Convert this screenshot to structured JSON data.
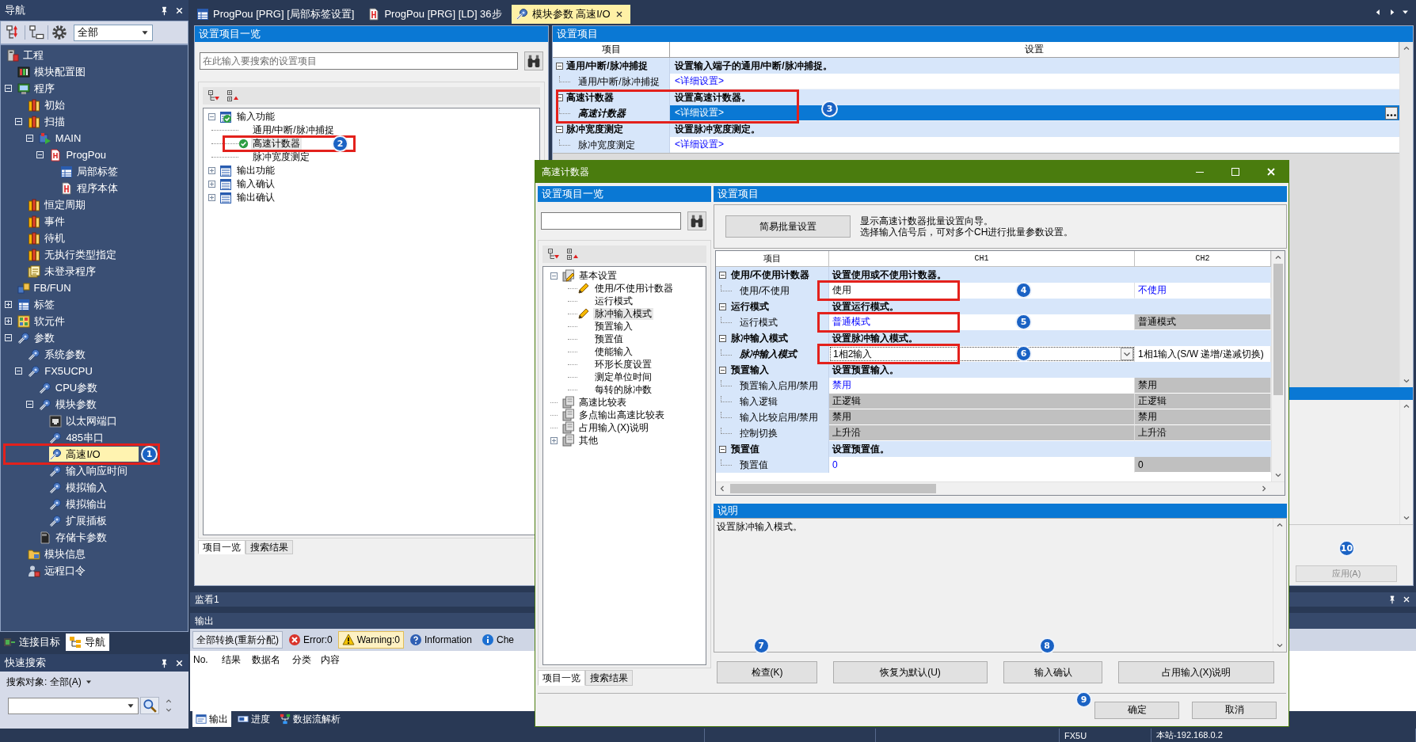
{
  "nav": {
    "title": "导航",
    "filter": "全部",
    "tree": [
      {
        "label": "工程",
        "kind": "pc",
        "selected": false,
        "children": [
          {
            "label": "模块配置图",
            "kind": "board",
            "selected": false
          },
          {
            "label": "程序",
            "kind": "screen",
            "selected": false,
            "expanded": true,
            "children": [
              {
                "label": "初始",
                "kind": "books",
                "selected": false
              },
              {
                "label": "扫描",
                "kind": "books",
                "selected": false,
                "expanded": true,
                "children": [
                  {
                    "label": "MAIN",
                    "kind": "block",
                    "selected": false,
                    "expanded": true,
                    "children": [
                      {
                        "label": "ProgPou",
                        "kind": "document",
                        "selected": false,
                        "expanded": true,
                        "children": [
                          {
                            "label": "局部标签",
                            "kind": "table",
                            "selected": false
                          },
                          {
                            "label": "程序本体",
                            "kind": "ladder",
                            "selected": false
                          }
                        ]
                      }
                    ]
                  }
                ]
              },
              {
                "label": "恒定周期",
                "kind": "books",
                "selected": false
              },
              {
                "label": "事件",
                "kind": "books",
                "selected": false
              },
              {
                "label": "待机",
                "kind": "books",
                "selected": false
              },
              {
                "label": "无执行类型指定",
                "kind": "books",
                "selected": false
              },
              {
                "label": "未登录程序",
                "kind": "pages",
                "selected": false
              }
            ]
          },
          {
            "label": "FB/FUN",
            "kind": "blocks",
            "selected": false
          },
          {
            "label": "标签",
            "kind": "table",
            "selected": false,
            "expanded": false
          },
          {
            "label": "软元件",
            "kind": "device",
            "selected": false,
            "expanded": false
          },
          {
            "label": "参数",
            "kind": "wrench",
            "selected": false,
            "expanded": true,
            "children": [
              {
                "label": "系统参数",
                "kind": "wrench",
                "selected": false
              },
              {
                "label": "FX5UCPU",
                "kind": "wrench",
                "selected": false,
                "expanded": true,
                "children": [
                  {
                    "label": "CPU参数",
                    "kind": "wrench",
                    "selected": false
                  },
                  {
                    "label": "模块参数",
                    "kind": "wrench",
                    "selected": false,
                    "expanded": true,
                    "children": [
                      {
                        "label": "以太网端口",
                        "kind": "port",
                        "selected": false
                      },
                      {
                        "label": "485串口",
                        "kind": "wrench",
                        "selected": false
                      },
                      {
                        "label": "高速I/O",
                        "kind": "wrench",
                        "selected": true,
                        "annotation": {
                          "number": "1",
                          "boxed": true
                        }
                      },
                      {
                        "label": "输入响应时间",
                        "kind": "wrench",
                        "selected": false
                      },
                      {
                        "label": "模拟输入",
                        "kind": "wrench",
                        "selected": false
                      },
                      {
                        "label": "模拟输出",
                        "kind": "wrench",
                        "selected": false
                      },
                      {
                        "label": "扩展插板",
                        "kind": "wrench",
                        "selected": false
                      }
                    ]
                  },
                  {
                    "label": "存储卡参数",
                    "kind": "card",
                    "selected": false
                  }
                ]
              },
              {
                "label": "模块信息",
                "kind": "folder",
                "selected": false
              },
              {
                "label": "远程口令",
                "kind": "lock",
                "selected": false
              }
            ]
          }
        ]
      }
    ],
    "tabs": [
      {
        "label": "连接目标",
        "kind": "link",
        "selected": false
      },
      {
        "label": "导航",
        "kind": "tree",
        "selected": true
      }
    ]
  },
  "quick_search": {
    "title": "快速搜索",
    "scope": "搜索对象: 全部(A)"
  },
  "doc_tabs": [
    {
      "label": "ProgPou [PRG] [局部标签设置]",
      "kind": "table",
      "selected": false
    },
    {
      "label": "ProgPou [PRG] [LD] 36步",
      "kind": "ladder",
      "selected": false
    },
    {
      "label": "模块参数 高速I/O",
      "kind": "wrench",
      "selected": true
    }
  ],
  "item_list": {
    "title": "设置项目一览",
    "placeholder": "在此输入要搜索的设置项目",
    "tree": [
      {
        "label": "输入功能",
        "expanded": true,
        "valid": true,
        "selected": false,
        "children": [
          {
            "label": "通用/中断/脉冲捕捉",
            "valid": false,
            "selected": false
          },
          {
            "label": "高速计数器",
            "valid": true,
            "selected": true,
            "annotation": {
              "number": "2",
              "boxed": true
            }
          },
          {
            "label": "脉冲宽度测定",
            "valid": false,
            "selected": false
          }
        ]
      },
      {
        "label": "输出功能",
        "expanded": false,
        "valid": false,
        "selected": false
      },
      {
        "label": "输入确认",
        "expanded": false,
        "valid": false,
        "selected": false
      },
      {
        "label": "输出确认",
        "expanded": false,
        "valid": false,
        "selected": false
      }
    ],
    "tabs": [
      {
        "label": "项目一览",
        "selected": true
      },
      {
        "label": "搜索结果",
        "selected": false
      }
    ]
  },
  "settings": {
    "title": "设置项目",
    "columns": [
      "项目",
      "设置"
    ],
    "rows": [
      {
        "kind": "group",
        "item": "通用/中断/脉冲捕捉",
        "text": "设置输入端子的通用/中断/脉冲捕捉。",
        "expanded": true
      },
      {
        "kind": "item",
        "item": "通用/中断/脉冲捕捉",
        "text": "<详细设置>",
        "selected": false
      },
      {
        "kind": "group",
        "item": "高速计数器",
        "text": "设置高速计数器。",
        "expanded": true,
        "annotation": {
          "number": "3",
          "boxed": true
        }
      },
      {
        "kind": "item",
        "item": "高速计数器",
        "text": "<详细设置>",
        "selected": true
      },
      {
        "kind": "group",
        "item": "脉冲宽度测定",
        "text": "设置脉冲宽度测定。",
        "expanded": true
      },
      {
        "kind": "item",
        "item": "脉冲宽度测定",
        "text": "<详细设置>",
        "selected": false
      }
    ],
    "apply_button": {
      "label": "应用(A)",
      "disabled": true,
      "annotation": {
        "number": "10"
      }
    }
  },
  "monitor": {
    "title": "监看1"
  },
  "output": {
    "title": "输出",
    "toolbar": [
      {
        "label": "全部转换(重新分配)",
        "kind": "convert",
        "selected": false
      },
      {
        "label": "Error:0",
        "kind": "error",
        "selected": false
      },
      {
        "label": "Warning:0",
        "kind": "warning",
        "selected": true
      },
      {
        "label": "Information",
        "kind": "information",
        "selected": false
      },
      {
        "label": "Che",
        "kind": "check",
        "selected": false
      }
    ],
    "columns": [
      "No.",
      "结果",
      "数据名",
      "分类",
      "内容"
    ],
    "tabs": [
      {
        "label": "输出",
        "kind": "output",
        "selected": true
      },
      {
        "label": "进度",
        "kind": "progress",
        "selected": false
      },
      {
        "label": "数据流解析",
        "kind": "dataflow",
        "selected": false
      }
    ]
  },
  "status_bar": [
    "FX5U",
    "本站-192.168.0.2"
  ],
  "dialog": {
    "title": "高速计数器",
    "item_list": {
      "title": "设置项目一览",
      "tree": [
        {
          "label": "基本设置",
          "expanded": true,
          "changed": true,
          "selected": false,
          "children": [
            {
              "label": "使用/不使用计数器",
              "changed": true,
              "selected": false
            },
            {
              "label": "运行模式",
              "changed": false,
              "selected": false
            },
            {
              "label": "脉冲输入模式",
              "changed": true,
              "selected": true
            },
            {
              "label": "预置输入",
              "changed": false,
              "selected": false
            },
            {
              "label": "预置值",
              "changed": false,
              "selected": false
            },
            {
              "label": "使能输入",
              "changed": false,
              "selected": false
            },
            {
              "label": "环形长度设置",
              "changed": false,
              "selected": false
            },
            {
              "label": "测定单位时间",
              "changed": false,
              "selected": false
            },
            {
              "label": "每转的脉冲数",
              "changed": false,
              "selected": false
            }
          ]
        },
        {
          "label": "高速比较表",
          "changed": false,
          "selected": false
        },
        {
          "label": "多点输出高速比较表",
          "changed": false,
          "selected": false
        },
        {
          "label": "占用输入(X)说明",
          "changed": false,
          "selected": false
        },
        {
          "label": "其他",
          "expanded": false,
          "changed": false,
          "selected": false
        }
      ],
      "tabs": [
        {
          "label": "项目一览",
          "selected": true
        },
        {
          "label": "搜索结果",
          "selected": false
        }
      ]
    },
    "settings": {
      "title": "设置项目",
      "batch_button": "简易批量设置",
      "batch_hint": [
        "显示高速计数器批量设置向导。",
        "选择输入信号后，可对多个CH进行批量参数设置。"
      ],
      "columns": [
        "项目",
        "CH1",
        "CH2"
      ],
      "rows": [
        {
          "kind": "group",
          "item": "使用/不使用计数器",
          "text": "设置使用或不使用计数器。",
          "expanded": true
        },
        {
          "kind": "item",
          "item": "使用/不使用",
          "selected": false,
          "cells": [
            {
              "kind": "text",
              "value": "使用",
              "disabled": false,
              "changed": true,
              "annotation": {
                "number": "4",
                "boxed": true
              }
            },
            {
              "kind": "text",
              "value": "不使用",
              "disabled": false,
              "changed": false
            }
          ]
        },
        {
          "kind": "group",
          "item": "运行模式",
          "text": "设置运行模式。",
          "expanded": true
        },
        {
          "kind": "item",
          "item": "运行模式",
          "selected": false,
          "cells": [
            {
              "kind": "text",
              "value": "普通模式",
              "disabled": false,
              "changed": false,
              "annotation": {
                "number": "5",
                "boxed": true
              }
            },
            {
              "kind": "text",
              "value": "普通模式",
              "disabled": true
            }
          ]
        },
        {
          "kind": "group",
          "item": "脉冲输入模式",
          "text": "设置脉冲输入模式。",
          "expanded": true
        },
        {
          "kind": "item",
          "item": "脉冲输入模式",
          "selected": true,
          "cells": [
            {
              "kind": "dropdown",
              "value": "1相2输入",
              "disabled": false,
              "changed": true,
              "annotation": {
                "number": "6",
                "boxed": true
              }
            },
            {
              "kind": "text",
              "value": "1相1输入(S/W 递增/递减切换)",
              "disabled": false,
              "changed": true
            }
          ]
        },
        {
          "kind": "group",
          "item": "预置输入",
          "text": "设置预置输入。",
          "expanded": true
        },
        {
          "kind": "item",
          "item": "预置输入启用/禁用",
          "selected": false,
          "cells": [
            {
              "kind": "text",
              "value": "禁用",
              "disabled": false,
              "changed": false
            },
            {
              "kind": "text",
              "value": "禁用",
              "disabled": true
            }
          ]
        },
        {
          "kind": "item",
          "item": "输入逻辑",
          "selected": false,
          "cells": [
            {
              "kind": "text",
              "value": "正逻辑",
              "disabled": true
            },
            {
              "kind": "text",
              "value": "正逻辑",
              "disabled": true
            }
          ]
        },
        {
          "kind": "item",
          "item": "输入比较启用/禁用",
          "selected": false,
          "cells": [
            {
              "kind": "text",
              "value": "禁用",
              "disabled": true
            },
            {
              "kind": "text",
              "value": "禁用",
              "disabled": true
            }
          ]
        },
        {
          "kind": "item",
          "item": "控制切换",
          "selected": false,
          "cells": [
            {
              "kind": "text",
              "value": "上升沿",
              "disabled": true
            },
            {
              "kind": "text",
              "value": "上升沿",
              "disabled": true
            }
          ]
        },
        {
          "kind": "group",
          "item": "预置值",
          "text": "设置预置值。",
          "expanded": true
        },
        {
          "kind": "item",
          "item": "预置值",
          "selected": false,
          "cells": [
            {
              "kind": "text",
              "value": "0",
              "disabled": false,
              "changed": false
            },
            {
              "kind": "text",
              "value": "0",
              "disabled": true
            }
          ]
        }
      ]
    },
    "description": {
      "title": "说明",
      "text": "设置脉冲输入模式。"
    },
    "buttons": [
      {
        "label": "检查(K)",
        "annotation": {
          "number": "7"
        }
      },
      {
        "label": "恢复为默认(U)"
      },
      {
        "label": "输入确认",
        "annotation": {
          "number": "8"
        }
      },
      {
        "label": "占用输入(X)说明"
      }
    ],
    "footer_buttons": [
      {
        "label": "确定",
        "annotation": {
          "number": "9"
        }
      },
      {
        "label": "取消"
      }
    ]
  }
}
